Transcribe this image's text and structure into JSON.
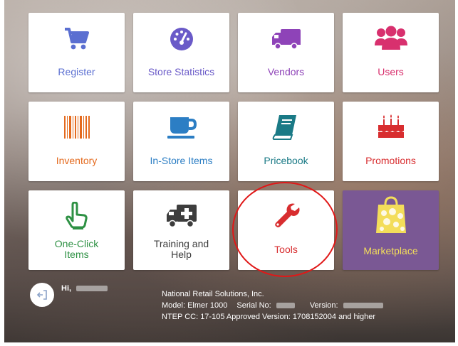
{
  "tiles": [
    {
      "name": "register",
      "label": "Register",
      "color": "#5b6fd1",
      "icon": "cart-icon"
    },
    {
      "name": "store-statistics",
      "label": "Store Statistics",
      "color": "#6a5ac8",
      "icon": "speedometer-icon"
    },
    {
      "name": "vendors",
      "label": "Vendors",
      "color": "#8e43b8",
      "icon": "truck-icon"
    },
    {
      "name": "users",
      "label": "Users",
      "color": "#d8306e",
      "icon": "users-icon"
    },
    {
      "name": "inventory",
      "label": "Inventory",
      "color": "#e46a1e",
      "icon": "barcode-icon"
    },
    {
      "name": "in-store-items",
      "label": "In-Store Items",
      "color": "#2c7ec4",
      "icon": "cup-icon"
    },
    {
      "name": "pricebook",
      "label": "Pricebook",
      "color": "#1a7a86",
      "icon": "book-icon"
    },
    {
      "name": "promotions",
      "label": "Promotions",
      "color": "#d82d2f",
      "icon": "cake-icon"
    },
    {
      "name": "one-click-items",
      "label": "One-Click\nItems",
      "color": "#2e9144",
      "icon": "hand-pointer-icon"
    },
    {
      "name": "training-and-help",
      "label": "Training and\nHelp",
      "color": "#3d3d3d",
      "icon": "ambulance-icon"
    },
    {
      "name": "tools",
      "label": "Tools",
      "color": "#d82d2f",
      "icon": "wrench-icon"
    },
    {
      "name": "marketplace",
      "label": "Marketplace",
      "color": "#f3dd5a",
      "icon": "shopping-bag-icon"
    }
  ],
  "footer": {
    "greeting": "Hi,",
    "company": "National Retail Solutions, Inc.",
    "model_label": "Model: Elmer 1000",
    "serial_label": "Serial No:",
    "version_label": "Version:",
    "ntep": "NTEP CC: 17-105 Approved Version: 1708152004 and higher"
  },
  "colors": {
    "tile_bg": "#ffffff",
    "marketplace_bg": "#7a5894",
    "highlight_circle": "#e01818"
  }
}
